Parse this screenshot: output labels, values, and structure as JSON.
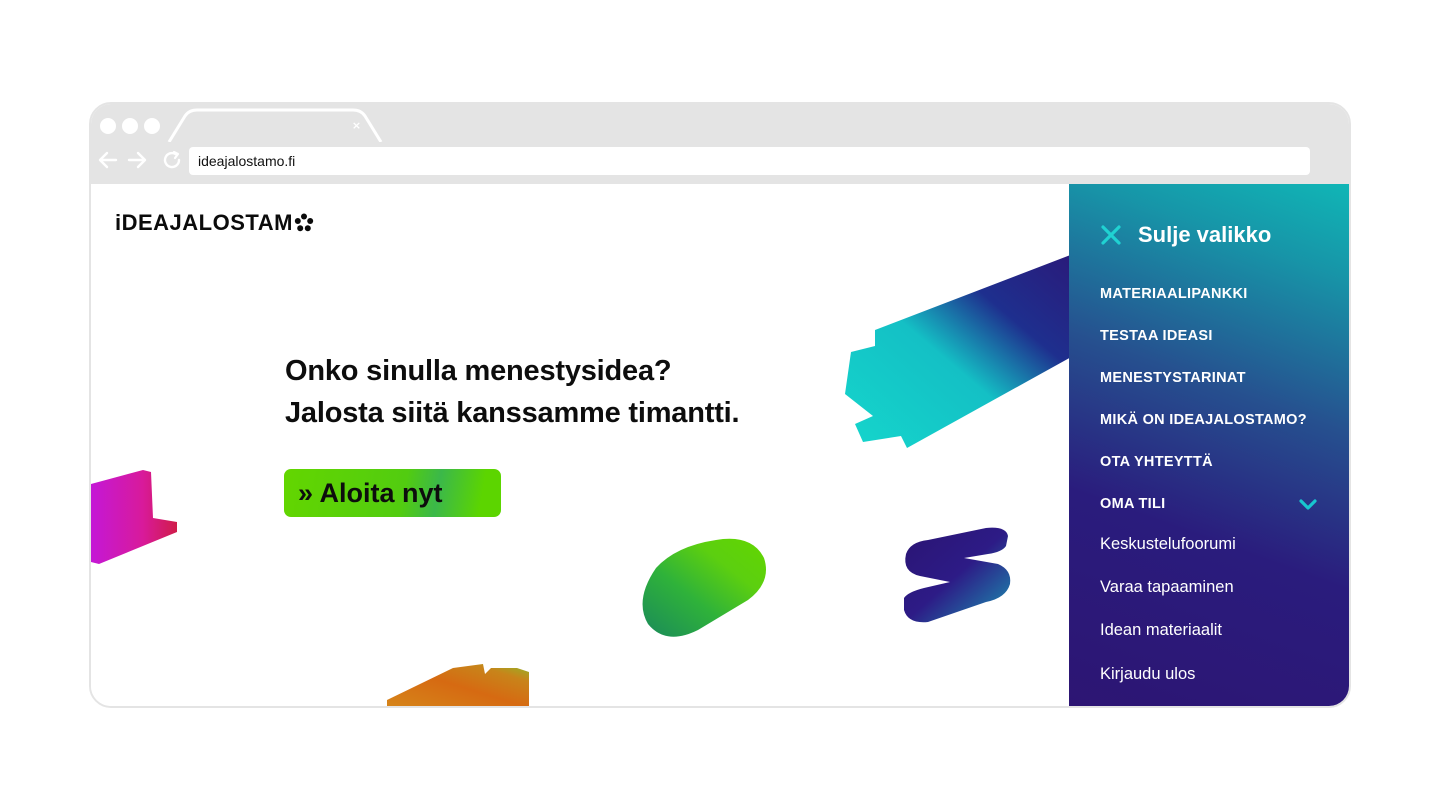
{
  "browser": {
    "url": "ideajalostamo.fi",
    "tab_close_glyph": "×",
    "icons": [
      "back-arrow-icon",
      "forward-arrow-icon",
      "reload-icon",
      "close-icon"
    ]
  },
  "site": {
    "logo_text": "iDEAJALOSTAM",
    "headline_line1": "Onko sinulla menestysidea?",
    "headline_line2": "Jalosta siitä kanssamme timantti.",
    "cta_label": "» Aloita nyt"
  },
  "menu": {
    "close_label": "Sulje valikko",
    "items": [
      {
        "label": "MATERIAALIPANKKI"
      },
      {
        "label": "TESTAA IDEASI"
      },
      {
        "label": "MENESTYSTARINAT"
      },
      {
        "label": "MIKÄ ON IDEAJALOSTAMO?"
      },
      {
        "label": "OTA YHTEYTTÄ"
      },
      {
        "label": "OMA TILI"
      }
    ],
    "sub_items": [
      {
        "label": "Keskustelufoorumi"
      },
      {
        "label": "Varaa tapaaminen"
      },
      {
        "label": "Idean materiaalit"
      },
      {
        "label": "Kirjaudu ulos"
      }
    ]
  },
  "colors": {
    "accent_green": "#5cd500",
    "menu_teal": "#10b6b6",
    "menu_purple": "#2d1573",
    "chevron": "#18c6cf"
  }
}
